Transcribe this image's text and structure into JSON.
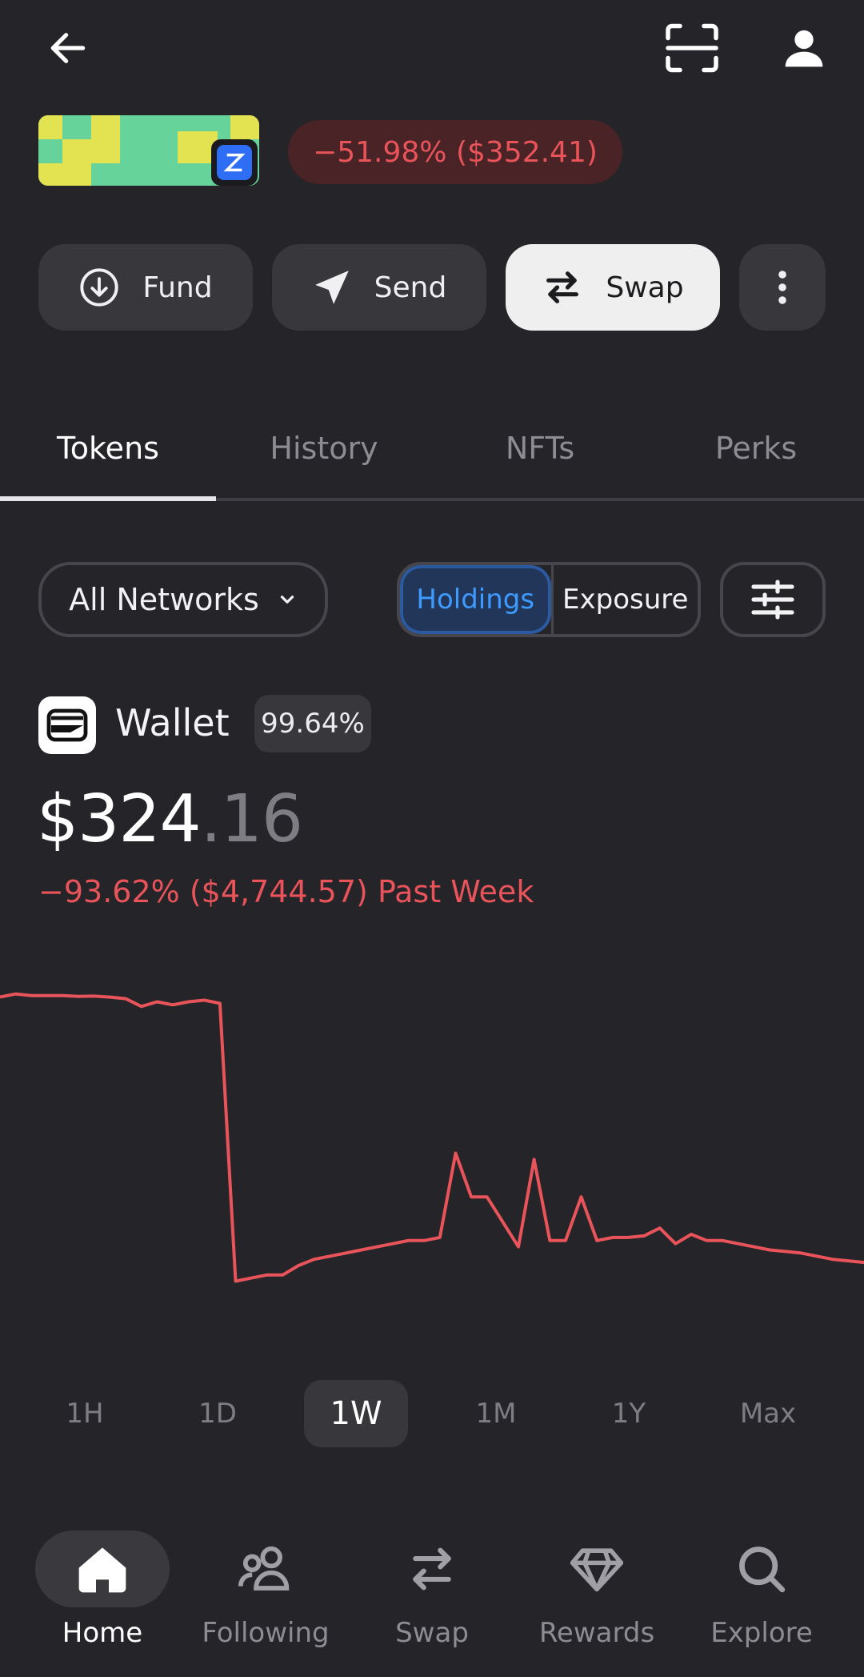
{
  "header": {
    "change_text": "−51.98% ($352.41)",
    "banner_colors": [
      "#66d49a",
      "#e3e250"
    ]
  },
  "actions": {
    "fund": "Fund",
    "send": "Send",
    "swap": "Swap"
  },
  "tabs": [
    {
      "label": "Tokens",
      "active": true
    },
    {
      "label": "History",
      "active": false
    },
    {
      "label": "NFTs",
      "active": false
    },
    {
      "label": "Perks",
      "active": false
    }
  ],
  "filters": {
    "network": "All Networks",
    "holdings": "Holdings",
    "exposure": "Exposure",
    "active_toggle": "Holdings"
  },
  "wallet": {
    "name": "Wallet",
    "percent": "99.64%",
    "balance_whole": "$324",
    "balance_cents": ".16",
    "week_change": "−93.62% ($4,744.57) Past Week"
  },
  "chart_data": {
    "type": "line",
    "period": "1W",
    "color": "#e8545a",
    "values": [
      96,
      97,
      96.5,
      96.5,
      96.5,
      96.2,
      96.3,
      96,
      95.5,
      93,
      94.5,
      93.5,
      94.5,
      95,
      94,
      5,
      6,
      7,
      7,
      10,
      12,
      13,
      14,
      15,
      16,
      17,
      18,
      18,
      19,
      46,
      32,
      32,
      24,
      16,
      44,
      18,
      18,
      32,
      18,
      19,
      19,
      19.5,
      22,
      17,
      20,
      18,
      18,
      17,
      16,
      15,
      14.5,
      14,
      13,
      12,
      11.5,
      11
    ]
  },
  "ranges": [
    {
      "label": "1H",
      "active": false
    },
    {
      "label": "1D",
      "active": false
    },
    {
      "label": "1W",
      "active": true
    },
    {
      "label": "1M",
      "active": false
    },
    {
      "label": "1Y",
      "active": false
    },
    {
      "label": "Max",
      "active": false
    }
  ],
  "nav": [
    {
      "label": "Home",
      "icon": "home-icon",
      "active": true
    },
    {
      "label": "Following",
      "icon": "following-icon",
      "active": false
    },
    {
      "label": "Swap",
      "icon": "swap-icon",
      "active": false
    },
    {
      "label": "Rewards",
      "icon": "diamond-icon",
      "active": false
    },
    {
      "label": "Explore",
      "icon": "search-icon",
      "active": false
    }
  ]
}
